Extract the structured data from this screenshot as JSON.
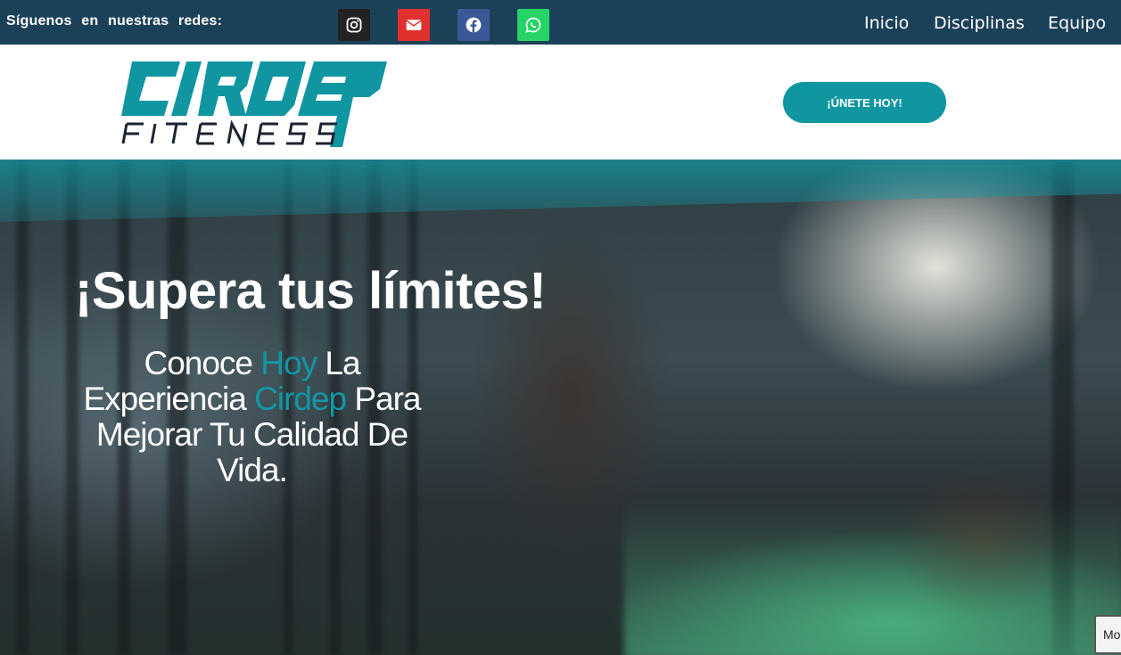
{
  "topbar": {
    "follow_text": "Síguenos en nuestras redes:",
    "social": [
      {
        "icon": "instagram-icon",
        "color": "#222222"
      },
      {
        "icon": "email-icon",
        "color": "#e0312f"
      },
      {
        "icon": "facebook-icon",
        "color": "#3b5998"
      },
      {
        "icon": "whatsapp-icon",
        "color": "#25d366"
      }
    ],
    "nav": [
      "Inicio",
      "Disciplinas",
      "Equipo"
    ],
    "background": "#1b4158"
  },
  "header": {
    "logo": {
      "line1": "CIRDEP",
      "line2": "FITNESS",
      "color": "#0f96a0"
    },
    "join_button": "¡ÚNETE HOY!"
  },
  "hero": {
    "headline": "¡Supera tus límites!",
    "sub": {
      "part1": "Conoce ",
      "hl1": "Hoy",
      "part2": " La Experiencia ",
      "hl2": "Cirdep",
      "part3": " Para Mejorar Tu Calidad De Vida."
    },
    "accent_color": "#1396a4"
  },
  "corner_button": "Mo"
}
